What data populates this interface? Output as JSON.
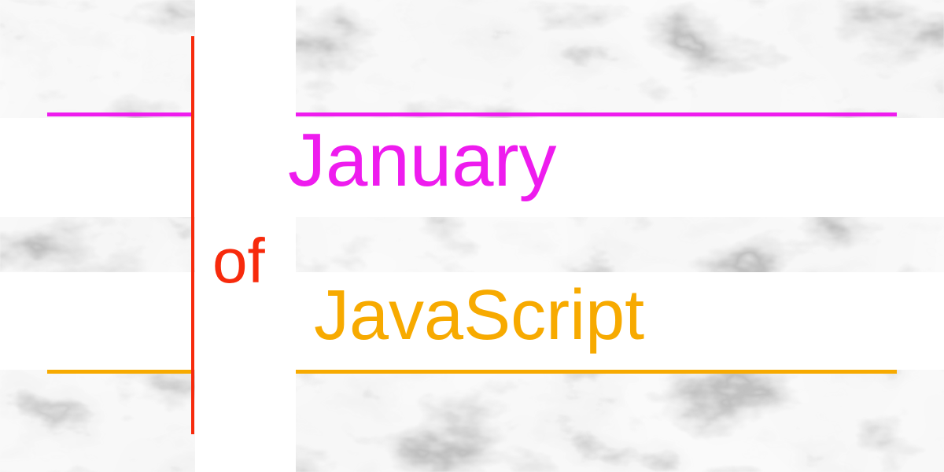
{
  "title": {
    "line1": "January",
    "line2": "of",
    "line3": "JavaScript"
  },
  "colors": {
    "line1": "#ee1cee",
    "line2": "#f72a0c",
    "line3": "#f7aa00",
    "vertical_rule": "#f72a0c",
    "background": "#ffffff",
    "marble_vein": "#9a9a9a"
  },
  "background": {
    "texture": "white marble"
  }
}
